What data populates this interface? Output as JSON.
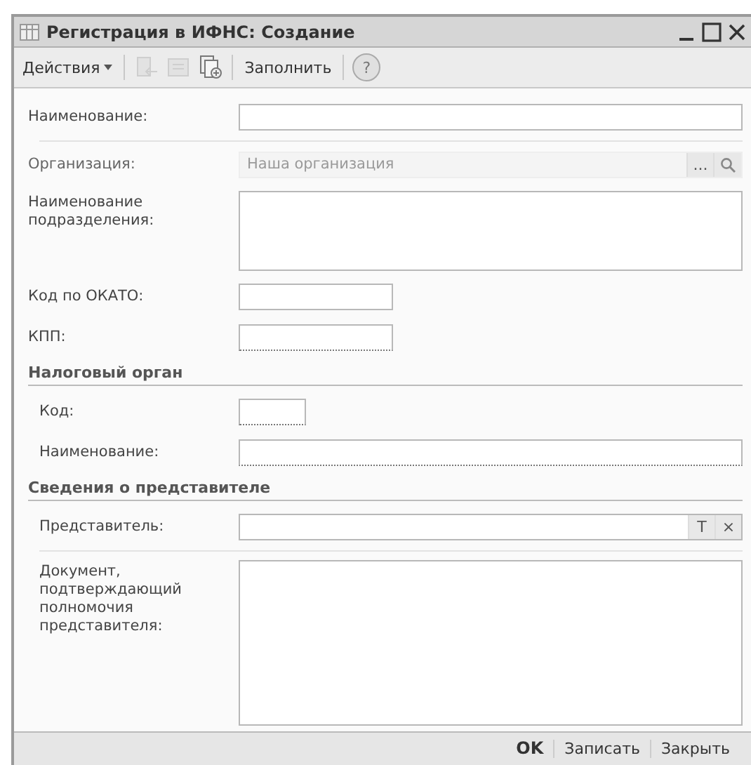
{
  "window": {
    "title": "Регистрация в ИФНС: Создание"
  },
  "toolbar": {
    "actions": "Действия",
    "icon_buttons": [
      {
        "kind": "move",
        "disabled": true
      },
      {
        "kind": "list",
        "disabled": true
      },
      {
        "kind": "copy",
        "disabled": false
      }
    ],
    "fill": "Заполнить",
    "help": "?"
  },
  "rows": [
    {
      "kind": "wide_field",
      "label": "Наименование:"
    },
    {
      "kind": "divider"
    },
    {
      "kind": "wide_field",
      "label": "Организация:",
      "value": "Наша организация",
      "disabled": true,
      "buttons": [
        "..."
      ],
      "search": true
    },
    {
      "kind": "text_area",
      "label": "Наименование подразделения:"
    },
    {
      "kind": "mid_field",
      "label": "Код по ОКАТО:"
    },
    {
      "kind": "mid_field",
      "label": "КПП:",
      "dotted": true
    },
    {
      "kind": "section",
      "label": "Налоговый орган",
      "children": [
        {
          "kind": "small_field",
          "label": "Код:",
          "dotted": true
        },
        {
          "kind": "wide_field",
          "label": "Наименование:",
          "dotted": true
        }
      ]
    },
    {
      "kind": "section",
      "label": "Сведения о представителе",
      "children": [
        {
          "kind": "wide_field",
          "label": "Представитель:",
          "buttons": [
            "T",
            "×"
          ]
        },
        {
          "kind": "divider"
        },
        {
          "kind": "tall_text_area",
          "label": "Документ, подтверждающий полномочия представителя:"
        }
      ]
    }
  ],
  "footer": [
    {
      "label": "OK",
      "default": true
    },
    {
      "label": "Записать",
      "default": false
    },
    {
      "label": "Закрыть",
      "default": false
    }
  ]
}
